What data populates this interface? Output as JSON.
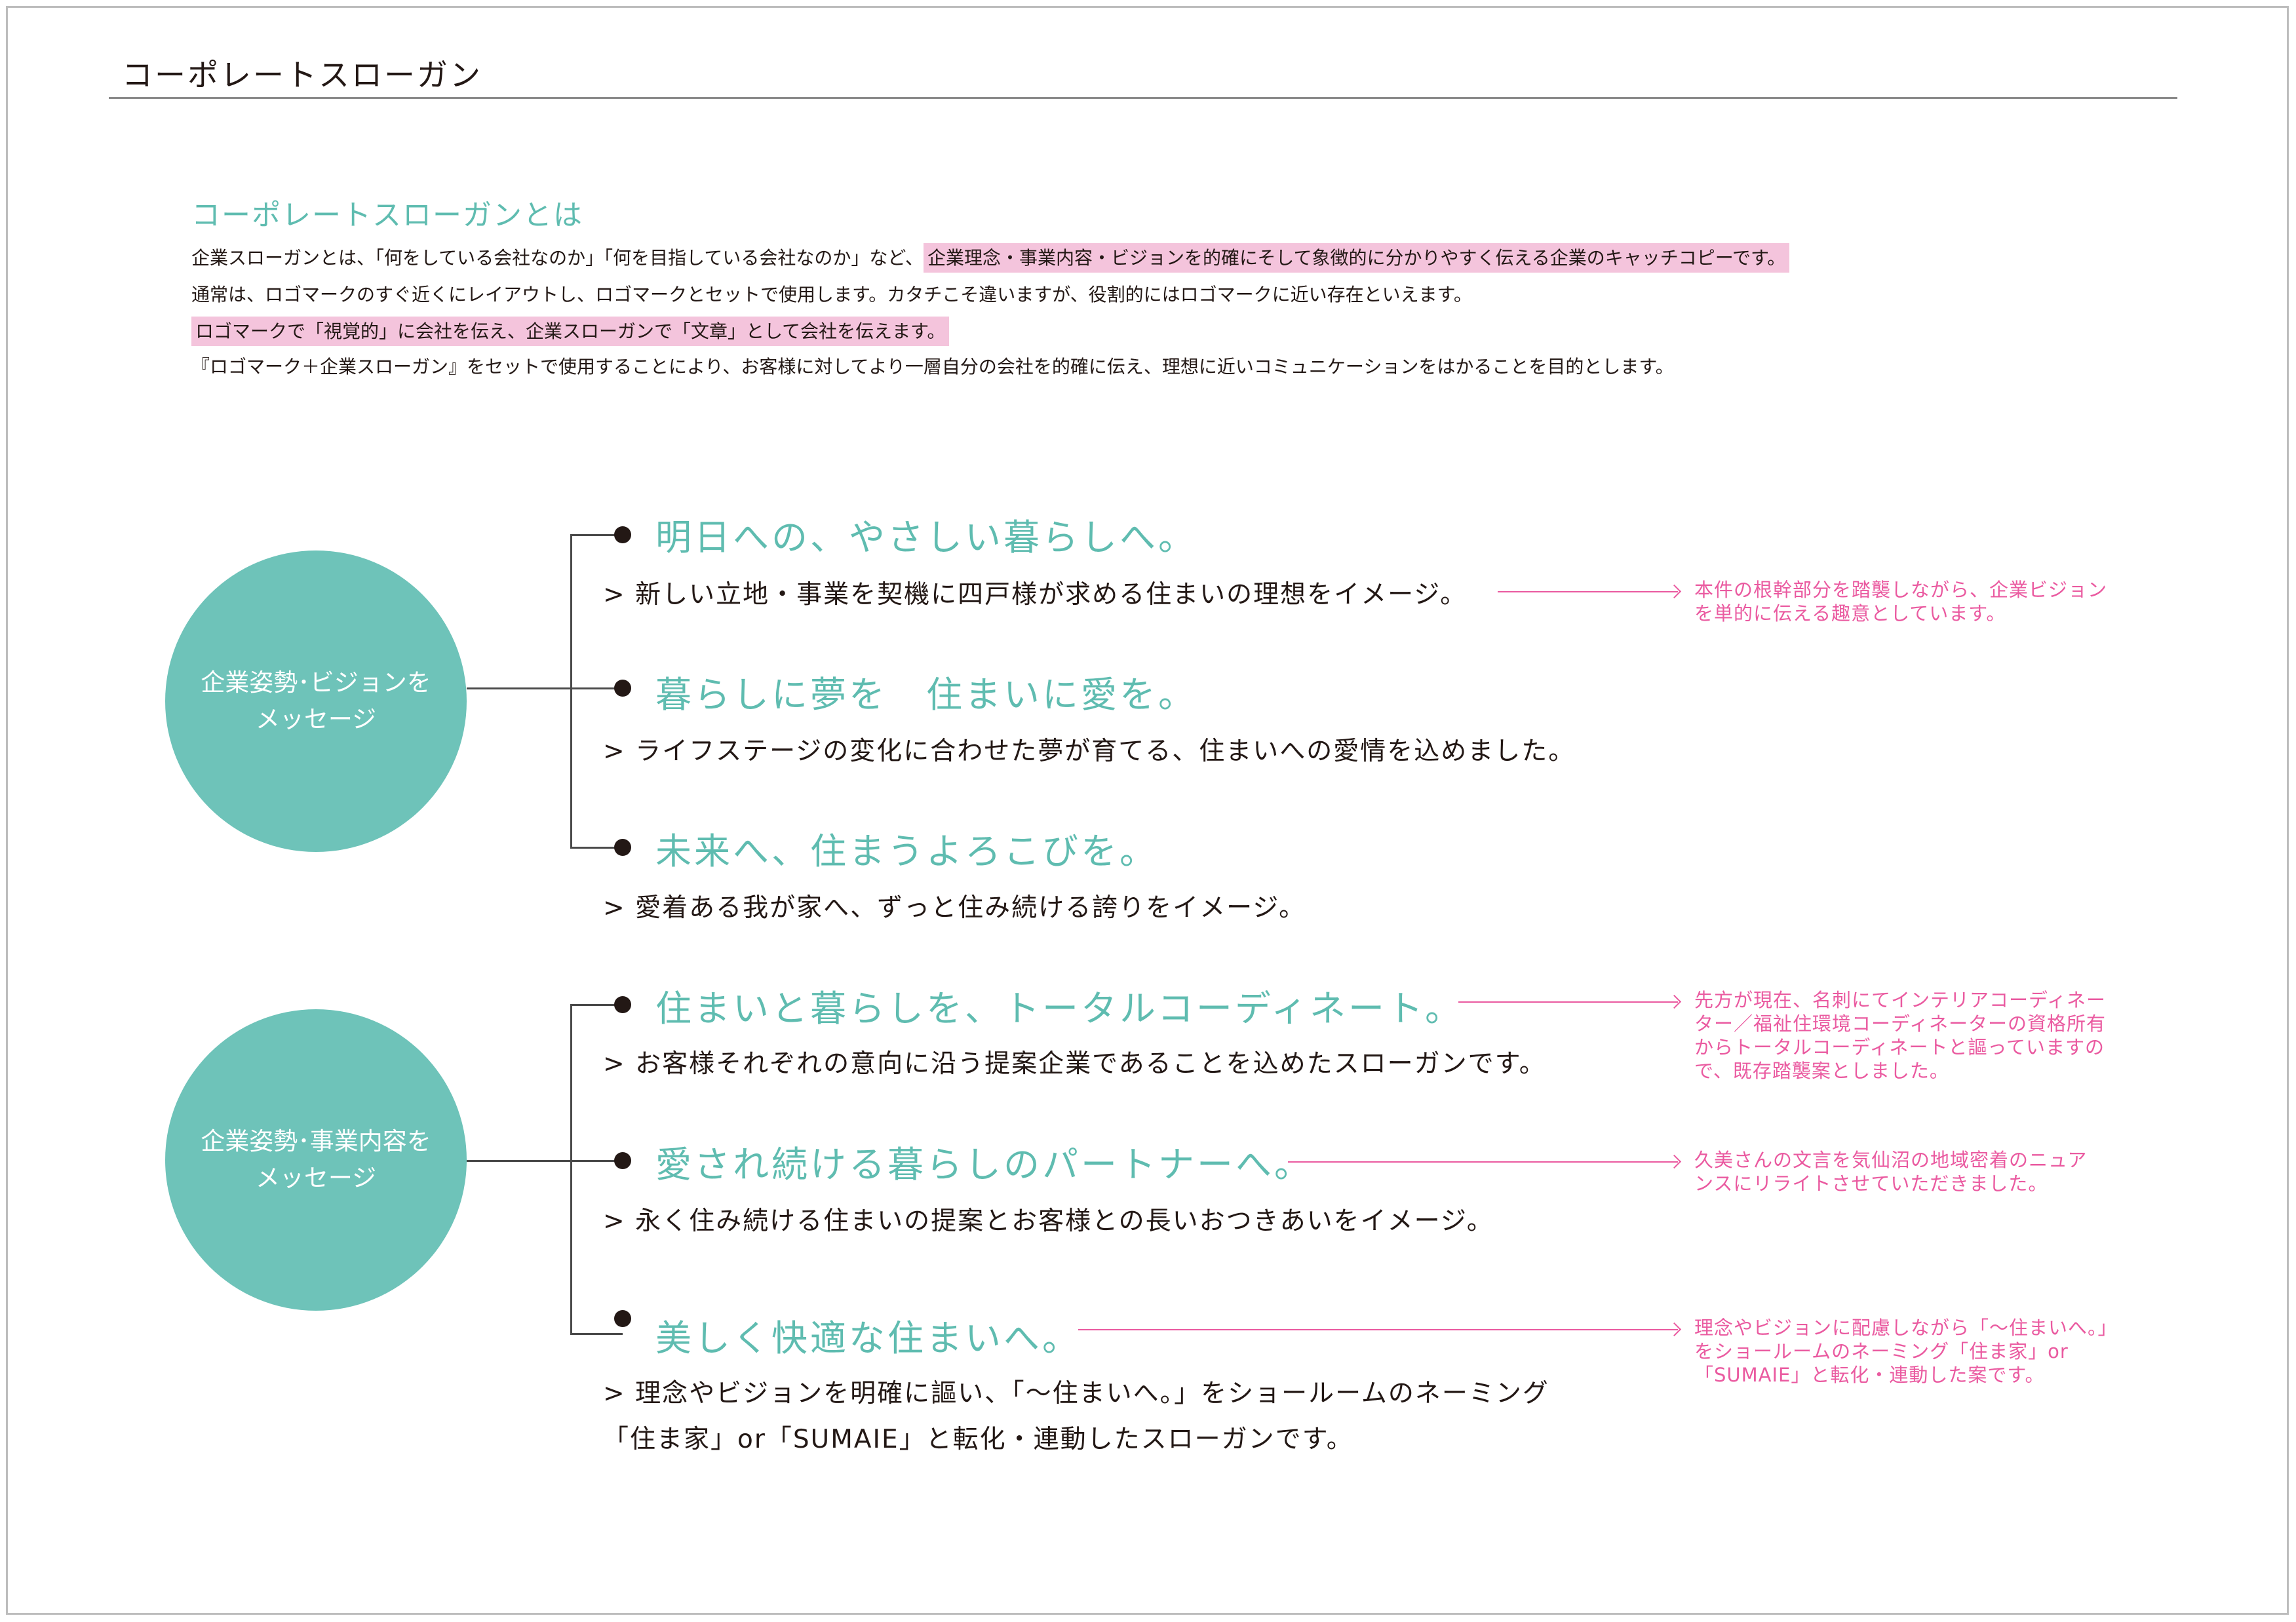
{
  "page": {
    "title": "コーポレートスローガン"
  },
  "intro": {
    "heading": "コーポレートスローガンとは",
    "line1_plain": "企業スローガンとは、「何をしている会社なのか」「何を目指している会社なのか」など、",
    "line1_highlight": "企業理念・事業内容・ビジョンを的確にそして象徴的に分かりやすく伝える企業のキャッチコピーです。",
    "line2": "通常は、ロゴマークのすぐ近くにレイアウトし、ロゴマークとセットで使用します。カタチこそ違いますが、役割的にはロゴマークに近い存在といえます。",
    "line3_highlight": "ロゴマークで「視覚的」に会社を伝え、企業スローガンで「文章」として会社を伝えます。",
    "line4": "『ロゴマーク＋企業スローガン』をセットで使用することにより、お客様に対してより一層自分の会社を的確に伝え、理想に近いコミュニケーションをはかることを目的とします。"
  },
  "colors": {
    "accent_teal": "#6ec3b9",
    "slogan_teal": "#5fbcb0",
    "highlight_pink": "#f4c4dc",
    "note_pink": "#ea5aa0"
  },
  "groups": [
    {
      "label_line1": "企業姿勢･ビジョンを",
      "label_line2": "メッセージ",
      "slogans": [
        {
          "title": "明日への、やさしい暮らしへ。",
          "desc": "> 新しい立地・事業を契機に四戸様が求める住まいの理想をイメージ。",
          "note": [
            "本件の根幹部分を踏襲しながら、企業ビジョン",
            "を単的に伝える趣意としています。"
          ]
        },
        {
          "title": "暮らしに夢を　住まいに愛を。",
          "desc": "> ライフステージの変化に合わせた夢が育てる、住まいへの愛情を込めました。"
        },
        {
          "title": "未来へ、住まうよろこびを。",
          "desc": "> 愛着ある我が家へ、ずっと住み続ける誇りをイメージ。"
        }
      ]
    },
    {
      "label_line1": "企業姿勢･事業内容を",
      "label_line2": "メッセージ",
      "slogans": [
        {
          "title": "住まいと暮らしを、トータルコーディネート。",
          "desc": "> お客様それぞれの意向に沿う提案企業であることを込めたスローガンです。",
          "note": [
            "先方が現在、名刺にてインテリアコーディネー",
            "ター／福祉住環境コーディネーターの資格所有",
            "からトータルコーディネートと謳っていますの",
            "で、既存踏襲案としました。"
          ]
        },
        {
          "title": "愛され続ける暮らしのパートナーへ。",
          "desc": "> 永く住み続ける住まいの提案とお客様との長いおつきあいをイメージ。",
          "note": [
            "久美さんの文言を気仙沼の地域密着のニュア",
            "ンスにリライトさせていただきました。"
          ]
        },
        {
          "title": "美しく快適な住まいへ。",
          "desc": "> 理念やビジョンを明確に謳い、「～住まいへ。」をショールームのネーミング",
          "desc2": "「住ま家」or「SUMAIE」と転化・連動したスローガンです。",
          "note": [
            "理念やビジョンに配慮しながら「～住まいへ。」",
            "をショールームのネーミング「住ま家」or",
            "「SUMAIE」と転化・連動した案です。"
          ]
        }
      ]
    }
  ]
}
